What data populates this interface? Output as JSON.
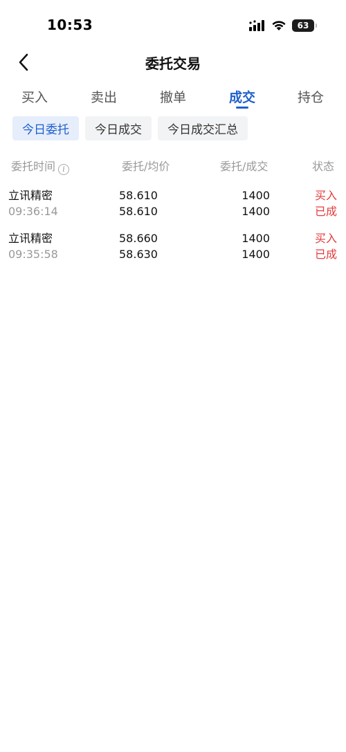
{
  "status_bar": {
    "time": "10:53",
    "battery": "63"
  },
  "nav": {
    "title": "委托交易"
  },
  "tabs": [
    {
      "label": "买入"
    },
    {
      "label": "卖出"
    },
    {
      "label": "撤单"
    },
    {
      "label": "成交"
    },
    {
      "label": "持仓"
    }
  ],
  "active_tab": "成交",
  "subtabs": [
    {
      "label": "今日委托"
    },
    {
      "label": "今日成交"
    },
    {
      "label": "今日成交汇总"
    }
  ],
  "active_subtab": "今日委托",
  "columns": {
    "time": "委托时间",
    "price": "委托/均价",
    "qty": "委托/成交",
    "status": "状态"
  },
  "orders": [
    {
      "name": "立讯精密",
      "time": "09:36:14",
      "order_price": "58.610",
      "avg_price": "58.610",
      "order_qty": "1400",
      "filled_qty": "1400",
      "direction": "买入",
      "status": "已成"
    },
    {
      "name": "立讯精密",
      "time": "09:35:58",
      "order_price": "58.660",
      "avg_price": "58.630",
      "order_qty": "1400",
      "filled_qty": "1400",
      "direction": "买入",
      "status": "已成"
    }
  ],
  "colors": {
    "accent": "#1f5fcc",
    "buy": "#e33b3b",
    "muted": "#999999"
  }
}
